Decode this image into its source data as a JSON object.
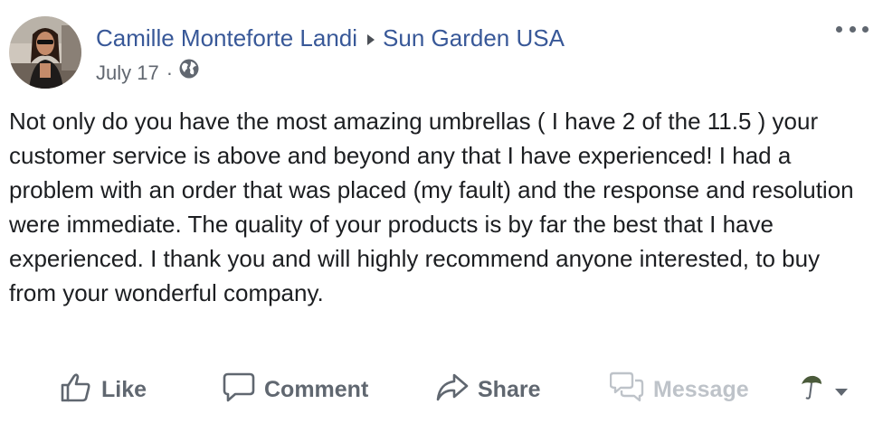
{
  "post": {
    "author": "Camille Monteforte Landi",
    "target": "Sun Garden USA",
    "date": "July 17",
    "separator": "·",
    "privacy_icon": "globe-icon",
    "more_icon": "ellipsis-icon",
    "body": "Not only do you have the most amazing umbrellas ( I have 2 of the 11.5 ) your customer service is above and beyond any that I have experienced! I had a problem with an order that was placed (my fault) and the response and resolution were immediate. The quality of your products is by far the best that I have experienced. I thank you and will highly recommend anyone interested, to buy from your wonderful company."
  },
  "actions": {
    "like": "Like",
    "comment": "Comment",
    "share": "Share",
    "message": "Message"
  },
  "colors": {
    "link": "#385898",
    "secondary_text": "#616770",
    "action_text": "#606770",
    "disabled_text": "#bec3c9",
    "body_text": "#1c1e21"
  }
}
